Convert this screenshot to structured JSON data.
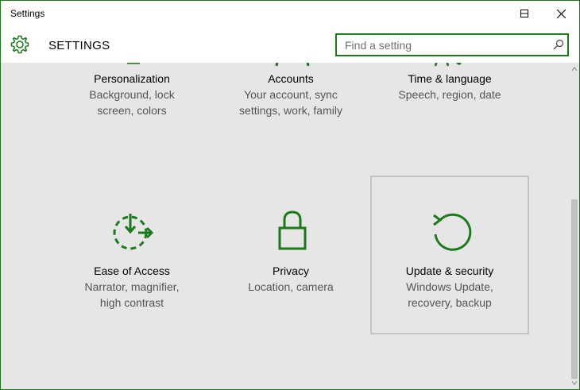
{
  "window": {
    "title": "Settings",
    "controls": {
      "minimize": "minimize-icon",
      "maximize": "maximize-icon",
      "close": "close-icon"
    }
  },
  "header": {
    "icon": "gear-icon",
    "title": "SETTINGS",
    "search": {
      "placeholder": "Find a setting",
      "value": "",
      "icon": "search-icon"
    }
  },
  "tiles": [
    {
      "title": "Personalization",
      "description": "Background, lock\nscreen, colors",
      "icon": "personalization-icon",
      "selected": false
    },
    {
      "title": "Accounts",
      "description": "Your account, sync\nsettings, work, family",
      "icon": "accounts-icon",
      "selected": false
    },
    {
      "title": "Time & language",
      "description": "Speech, region, date",
      "icon": "time-language-icon",
      "selected": false
    },
    {
      "title": "Ease of Access",
      "description": "Narrator, magnifier,\nhigh contrast",
      "icon": "ease-of-access-icon",
      "selected": false
    },
    {
      "title": "Privacy",
      "description": "Location, camera",
      "icon": "privacy-icon",
      "selected": false
    },
    {
      "title": "Update & security",
      "description": "Windows Update,\nrecovery, backup",
      "icon": "update-security-icon",
      "selected": true
    }
  ],
  "colors": {
    "accent": "#1a7a1a",
    "background": "#e6e6e6",
    "selection_border": "#c4c4c4"
  }
}
